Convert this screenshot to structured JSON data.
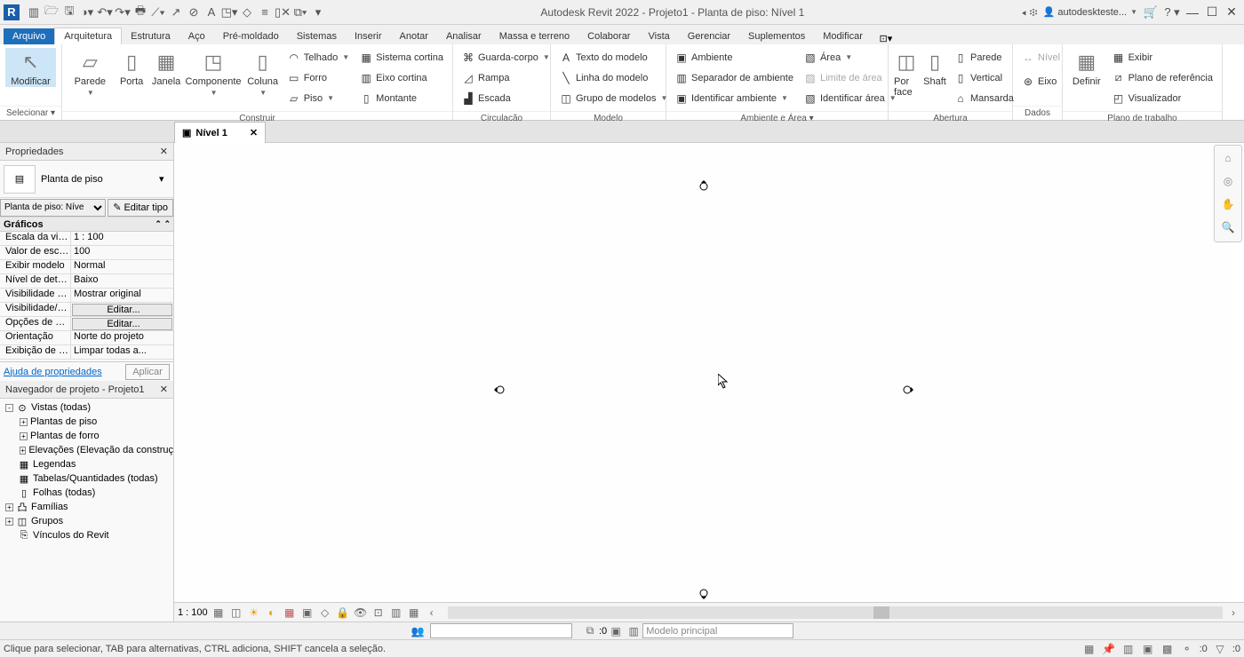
{
  "title": "Autodesk Revit 2022 - Projeto1 - Planta de piso: Nível 1",
  "user": "autodeskteste...",
  "logo": "R",
  "tabs": {
    "file": "Arquivo",
    "list": [
      "Arquitetura",
      "Estrutura",
      "Aço",
      "Pré-moldado",
      "Sistemas",
      "Inserir",
      "Anotar",
      "Analisar",
      "Massa e terreno",
      "Colaborar",
      "Vista",
      "Gerenciar",
      "Suplementos",
      "Modificar"
    ],
    "active": 0
  },
  "panels": {
    "select": {
      "title": "Selecionar ▾",
      "modify": "Modificar"
    },
    "build": {
      "title": "Construir",
      "items": [
        "Parede",
        "Porta",
        "Janela",
        "Componente",
        "Coluna"
      ],
      "small": [
        [
          "Telhado",
          "Forro",
          "Piso"
        ],
        [
          "Sistema cortina",
          "Eixo cortina",
          "Montante"
        ]
      ]
    },
    "circ": {
      "title": "Circulação",
      "small": [
        "Guarda-corpo",
        "Rampa",
        "Escada"
      ]
    },
    "model": {
      "title": "Modelo",
      "small": [
        "Texto do modelo",
        "Linha do modelo",
        "Grupo de modelos"
      ]
    },
    "room": {
      "title": "Ambiente e Área ▾",
      "col1": [
        "Ambiente",
        "Separador de ambiente",
        "Identificar ambiente"
      ],
      "col2": [
        "Área",
        "Limite de área",
        "Identificar área"
      ]
    },
    "open": {
      "title": "Abertura",
      "porface": "Por face",
      "shaft": "Shaft",
      "small": [
        "Parede",
        "Vertical",
        "Mansarda"
      ]
    },
    "datum": {
      "title": "Dados",
      "nivel": "Nível",
      "eixo": "Eixo"
    },
    "work": {
      "title": "Plano de trabalho",
      "definir": "Definir",
      "small": [
        "Exibir",
        "Plano de referência",
        "Visualizador"
      ]
    }
  },
  "viewtab": "Nível 1",
  "propsPane": {
    "title": "Propriedades",
    "typeName": "Planta de piso",
    "instanceSel": "Planta de piso: Níve",
    "editType": "Editar tipo",
    "group": "Gráficos",
    "rows": [
      {
        "l": "Escala da vista",
        "v": "1 : 100"
      },
      {
        "l": "Valor de escal...",
        "v": "100"
      },
      {
        "l": "Exibir modelo",
        "v": "Normal"
      },
      {
        "l": "Nível de detalhe",
        "v": "Baixo"
      },
      {
        "l": "Visibilidade d...",
        "v": "Mostrar original"
      },
      {
        "l": "Visibilidade/S...",
        "v": "Editar...",
        "btn": true
      },
      {
        "l": "Opções de exi...",
        "v": "Editar...",
        "btn": true
      },
      {
        "l": "Orientação",
        "v": "Norte do projeto"
      },
      {
        "l": "Exibição de u...",
        "v": "Limpar todas a..."
      }
    ],
    "help": "Ajuda de propriedades",
    "apply": "Aplicar"
  },
  "browser": {
    "title": "Navegador de projeto - Projeto1",
    "nodes": [
      {
        "l": 1,
        "exp": "-",
        "icon": "⊙",
        "t": "Vistas (todas)"
      },
      {
        "l": 2,
        "exp": "+",
        "t": "Plantas de piso"
      },
      {
        "l": 2,
        "exp": "+",
        "t": "Plantas de forro"
      },
      {
        "l": 2,
        "exp": "+",
        "t": "Elevações (Elevação da construç"
      },
      {
        "l": 1,
        "icon": "▦",
        "t": "Legendas"
      },
      {
        "l": 1,
        "icon": "▦",
        "t": "Tabelas/Quantidades (todas)"
      },
      {
        "l": 1,
        "icon": "▯",
        "t": "Folhas (todas)"
      },
      {
        "l": 1,
        "exp": "+",
        "icon": "凸",
        "t": "Famílias"
      },
      {
        "l": 1,
        "exp": "+",
        "icon": "◫",
        "t": "Grupos"
      },
      {
        "l": 1,
        "icon": "⎘",
        "t": "Vínculos do Revit"
      }
    ]
  },
  "viewctrl": {
    "scale": "1 : 100"
  },
  "status2": {
    "sel": ":0",
    "model": "Modelo principal"
  },
  "status": {
    "hint": "Clique para selecionar, TAB para alternativas, CTRL adiciona, SHIFT cancela a seleção.",
    "r": [
      ":0",
      ":0"
    ]
  }
}
